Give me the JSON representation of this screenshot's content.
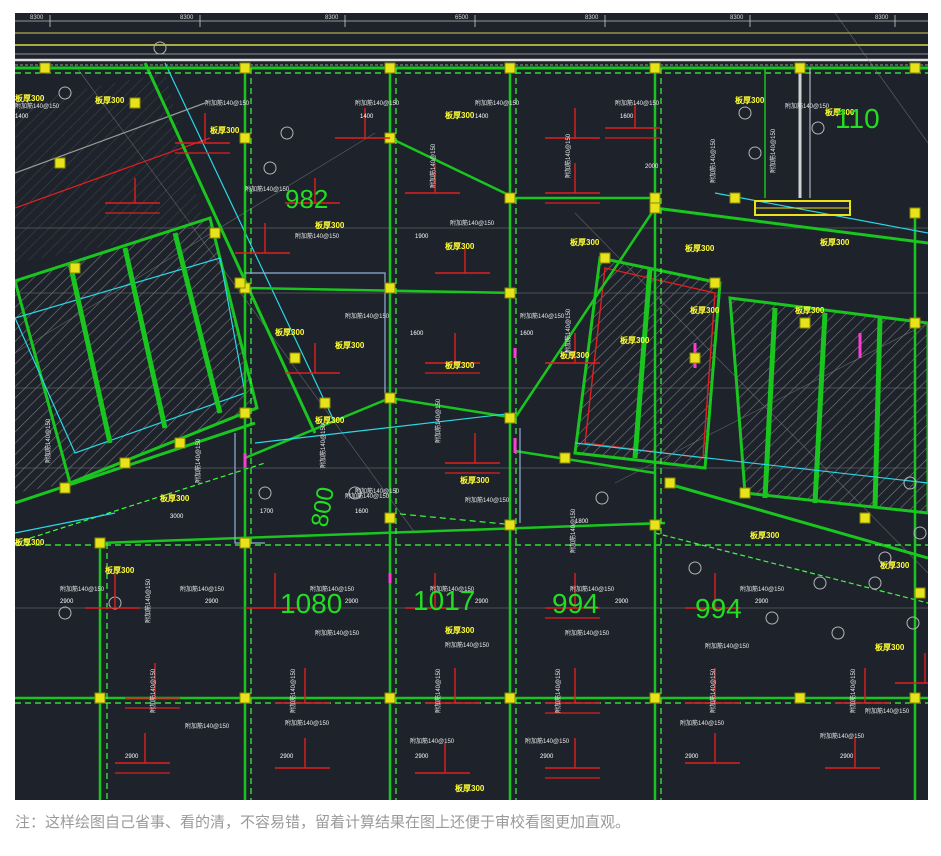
{
  "caption": "注：这样绘图自己省事、看的清，不容易错，留着计算结果在图上还便于审校看图更加直观。",
  "top_dimensions": [
    "8300",
    "8300",
    "8300",
    "6500",
    "8300",
    "8300",
    "8300"
  ],
  "area_labels": [
    "982",
    "110",
    "1080",
    "1017",
    "994",
    "994",
    "800"
  ],
  "beam_label": "板厚300",
  "rebar_label": "附加筋140@150",
  "span_labels": [
    "1400",
    "1600",
    "1800",
    "1900",
    "2000",
    "3000",
    "1700",
    "2900"
  ],
  "colors": {
    "background": "#1d222b",
    "beam_green": "#19c51e",
    "dashed_green": "#39ff3a",
    "column_yellow": "#e8e21a",
    "label_yellow": "#ffff33",
    "rebar_red": "#e02020",
    "cyan": "#2ad7e6",
    "magenta": "#ff3bd7",
    "grid_gray": "#8c8c8c",
    "area_green": "#22dd22"
  }
}
